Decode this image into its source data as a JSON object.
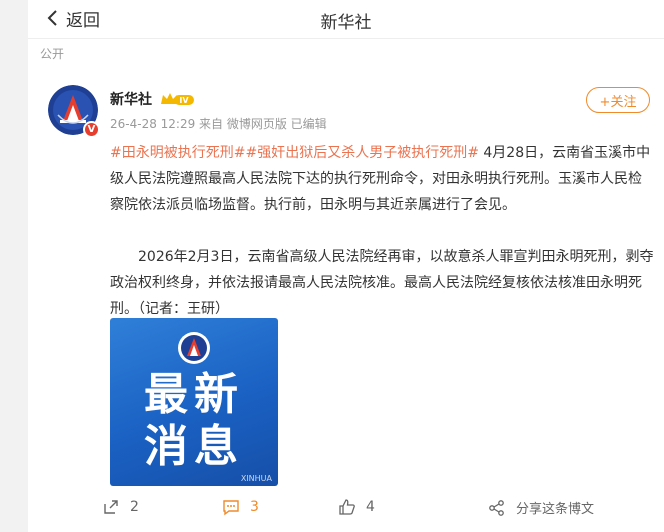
{
  "topbar": {
    "back_label": "返回",
    "title": "新华社"
  },
  "visibility": "公开",
  "post": {
    "author": "新华社",
    "level_badge": "IV",
    "meta": "26-4-28 12:29  来自 微博网页版 已编辑",
    "follow_label": "+关注",
    "tag1": "#田永明被执行死刑#",
    "tag2": "#强奸出狱后又杀人男子被执行死刑#",
    "para1": " 4月28日，云南省玉溪市中级人民法院遵照最高人民法院下达的执行死刑命令，对田永明执行死刑。玉溪市人民检察院依法派员临场监督。执行前，田永明与其近亲属进行了会见。",
    "para2": "2026年2月3日，云南省高级人民法院经再审，以故意杀人罪宣判田永明死刑，剥夺政治权利终身，并依法报请最高人民法院核准。最高人民法院经复核依法核准田永明死刑。（记者：王研）",
    "image": {
      "line1": "最新",
      "line2": "消息",
      "logo_text": "XINHUA"
    }
  },
  "actions": {
    "repost": "2",
    "comment": "3",
    "like": "4",
    "share": "分享这条博文"
  },
  "colors": {
    "tag": "#eb7350",
    "follow": "#f08a2b",
    "accent_blue": "#1a61c3"
  }
}
